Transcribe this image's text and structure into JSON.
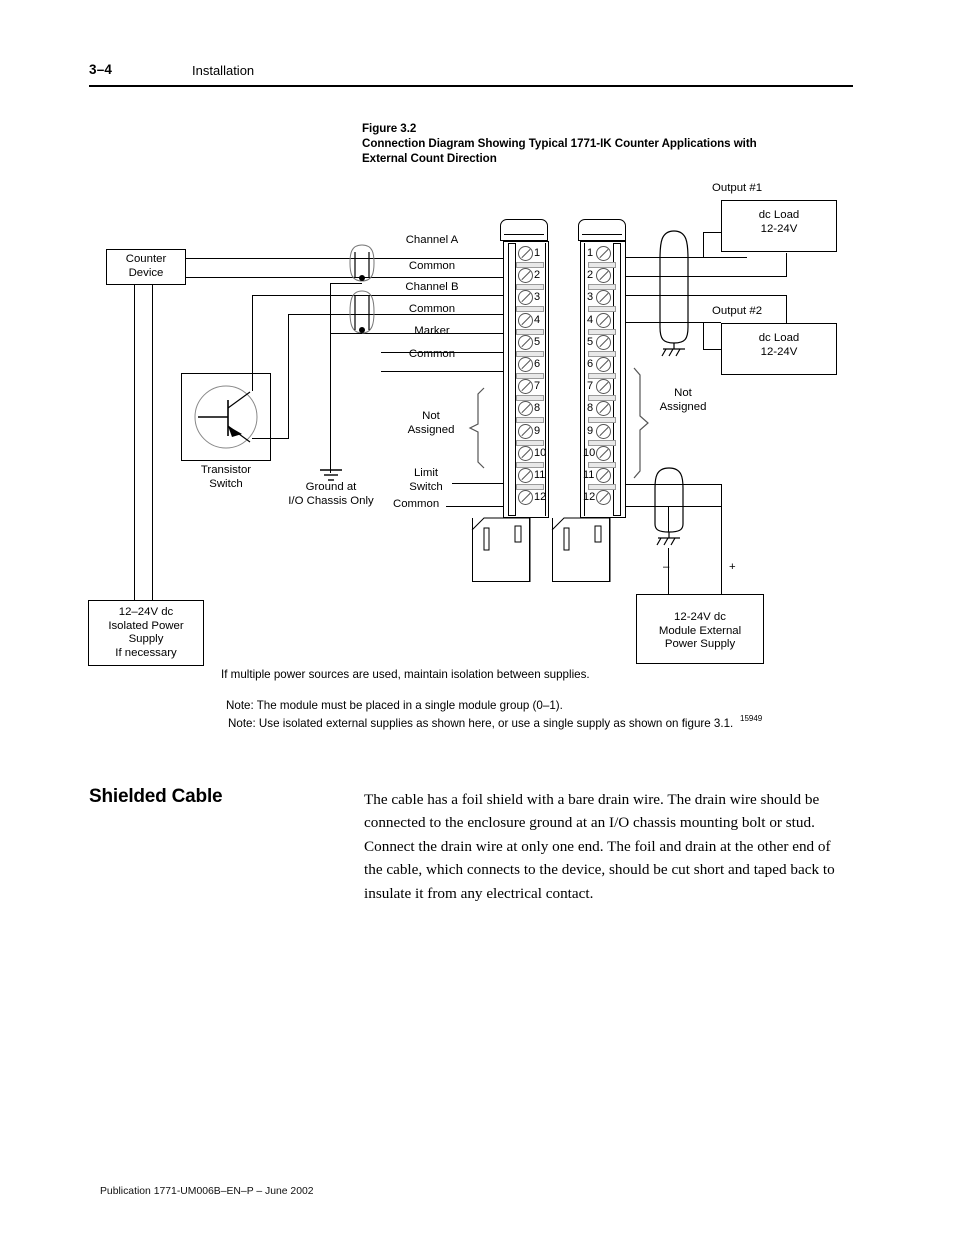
{
  "header": {
    "page_number": "3–4",
    "section": "Installation"
  },
  "figure": {
    "number": "Figure 3.2",
    "title_line1": "Connection Diagram Showing Typical 1771-IK Counter Applications with",
    "title_line2": "External Count Direction",
    "art_number": "15949"
  },
  "diagram": {
    "counter_device": {
      "line1": "Counter",
      "line2": "Device"
    },
    "transistor_switch": {
      "line1": "Transistor",
      "line2": "Switch"
    },
    "ground_note": {
      "line1": "Ground  at",
      "line2": "I/O Chassis Only"
    },
    "left_signal_labels": [
      "Channel A",
      "Common",
      "Channel  B",
      "Common",
      "Marker",
      "Common"
    ],
    "left_not_assigned": {
      "line1": "Not",
      "line2": "Assigned"
    },
    "left_limit_switch": {
      "line1": "Limit",
      "line2": "Switch"
    },
    "left_common": "Common",
    "right_not_assigned": {
      "line1": "Not",
      "line2": "Assigned"
    },
    "terminal_numbers": [
      "1",
      "2",
      "3",
      "4",
      "5",
      "6",
      "7",
      "8",
      "9",
      "10",
      "11",
      "12"
    ],
    "output1_label": "Output #1",
    "output2_label": "Output #2",
    "dc_load": {
      "line1": "dc Load",
      "line2": "12-24V"
    },
    "isolated_supply": {
      "line1": "12–24V dc",
      "line2": "Isolated Power",
      "line3": "Supply",
      "line4": "If necessary"
    },
    "module_supply": {
      "line1": "12-24V  dc",
      "line2": "Module  External",
      "line3": "Power  Supply"
    },
    "polarity_minus": "–",
    "polarity_plus": "+",
    "notes": [
      "If multiple power sources are used, maintain isolation between supplies.",
      "Note: The module must be placed in a single module group (0–1).",
      "Note: Use isolated external supplies as shown here, or use a single supply as shown on figure 3.1."
    ]
  },
  "shielded_cable": {
    "heading": "Shielded Cable",
    "paragraph": "The cable has a foil shield with a bare drain wire.  The drain wire should be connected to the enclosure ground at an I/O chassis mounting bolt or stud.  Connect the drain wire at only one end.  The foil and drain at the other end of the cable, which connects to the device, should be cut short and taped back to insulate it from any electrical contact."
  },
  "footer": {
    "publication": "Publication 1771-UM006B–EN–P – June 2002"
  },
  "colors": {
    "ink": "#000000",
    "paper": "#ffffff",
    "strip": "#e9e9e9"
  }
}
